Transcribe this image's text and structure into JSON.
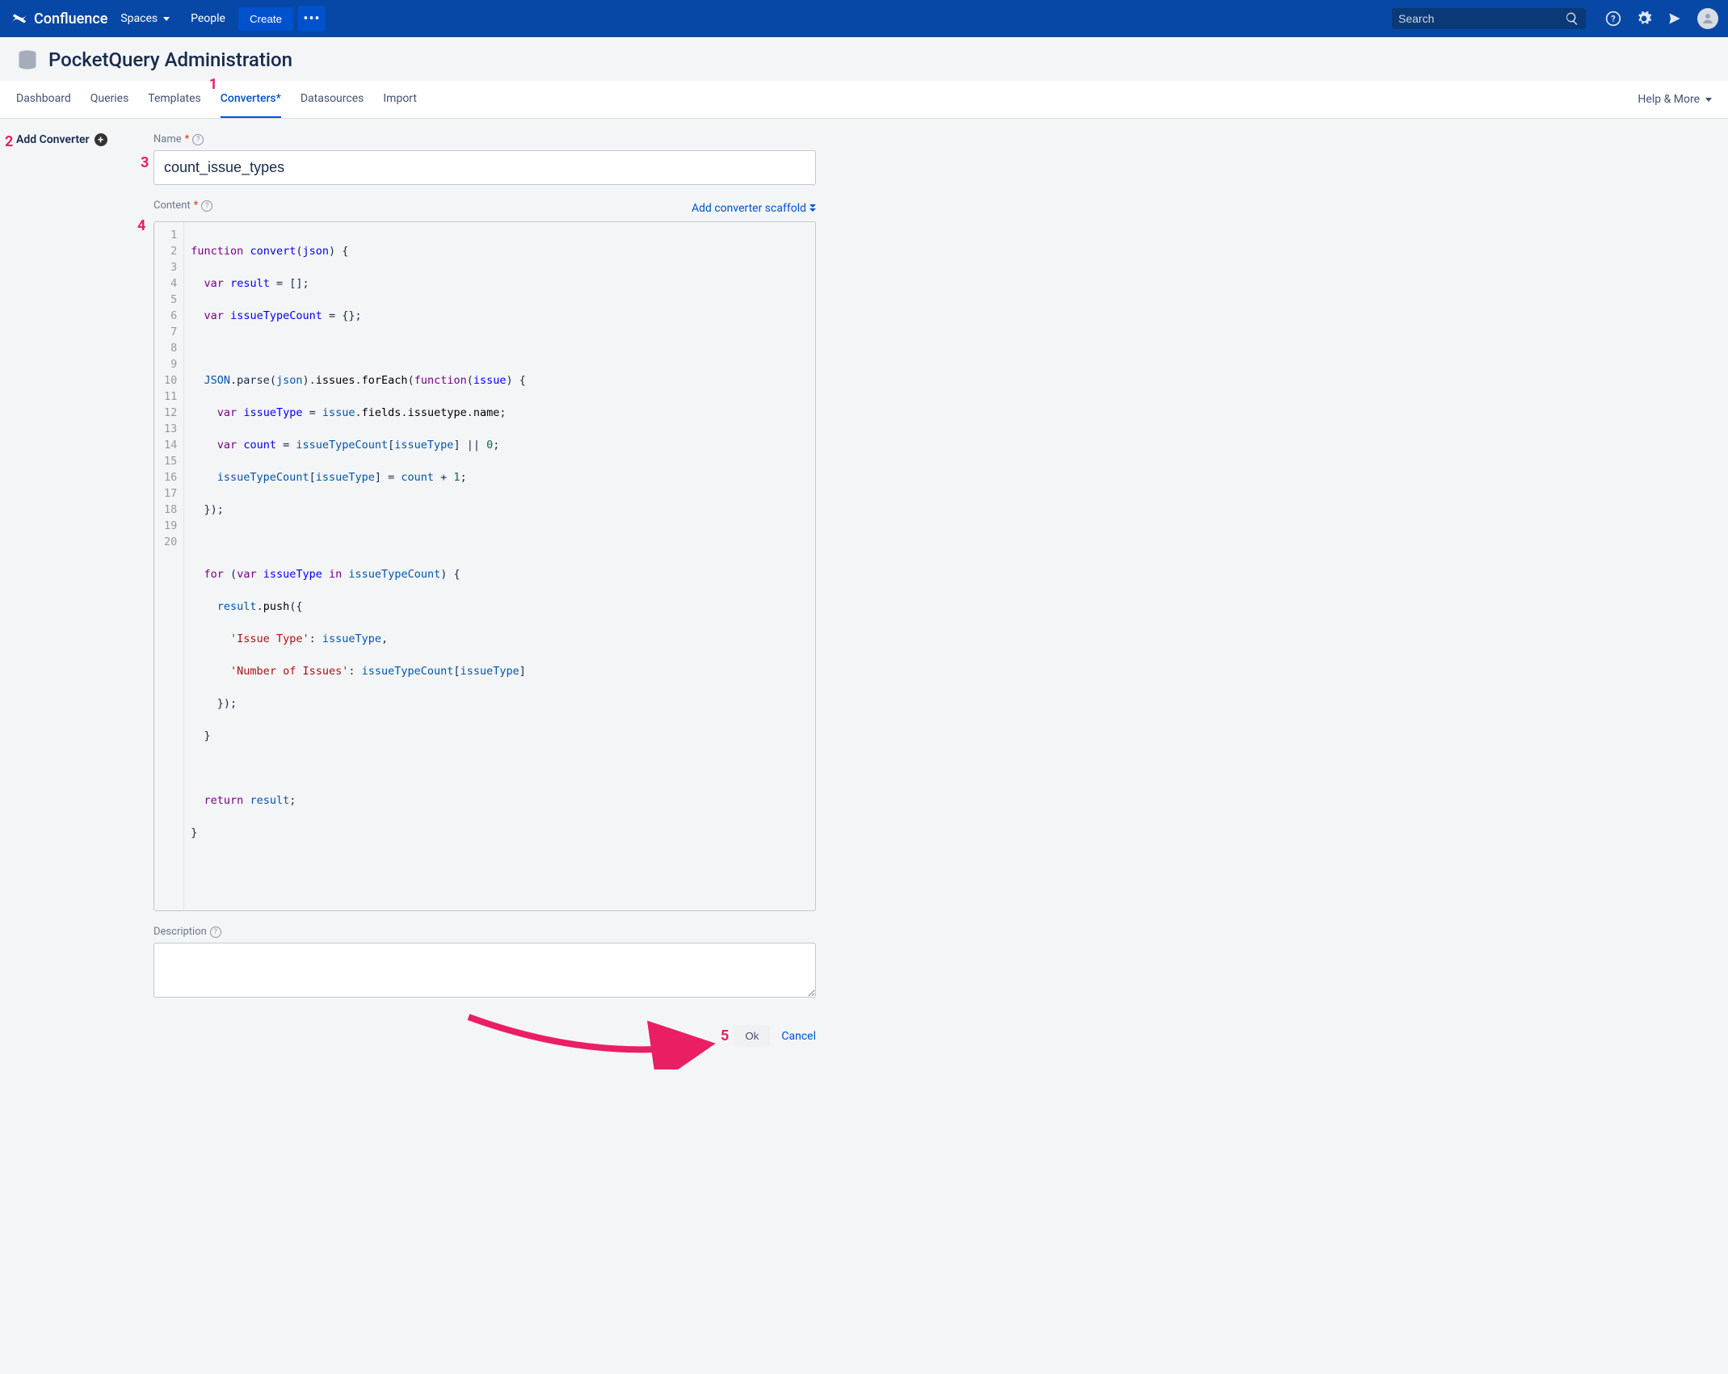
{
  "topbar": {
    "product": "Confluence",
    "spaces": "Spaces",
    "people": "People",
    "create": "Create",
    "more": "•••",
    "search_placeholder": "Search"
  },
  "page": {
    "title": "PocketQuery Administration"
  },
  "tabs": {
    "dashboard": "Dashboard",
    "queries": "Queries",
    "templates": "Templates",
    "converters": "Converters*",
    "datasources": "Datasources",
    "import": "Import",
    "help": "Help & More"
  },
  "sidebar": {
    "add_converter": "Add Converter"
  },
  "form": {
    "name_label": "Name",
    "name_value": "count_issue_types",
    "content_label": "Content",
    "scaffold": "Add converter scaffold",
    "description_label": "Description",
    "description_value": ""
  },
  "code": {
    "lines": 20,
    "line1_a": "function",
    "line1_b": "convert",
    "line1_c": "(",
    "line1_d": "json",
    "line1_e": ") {",
    "line2_a": "var",
    "line2_b": "result",
    "line2_c": " = [];",
    "line3_a": "var",
    "line3_b": "issueTypeCount",
    "line3_c": " = {};",
    "line5_a": "JSON",
    "line5_b": ".parse(",
    "line5_c": "json",
    "line5_d": ").",
    "line5_e": "issues",
    "line5_f": ".",
    "line5_g": "forEach",
    "line5_h": "(",
    "line5_i": "function",
    "line5_j": "(",
    "line5_k": "issue",
    "line5_l": ") {",
    "line6_a": "var",
    "line6_b": "issueType",
    "line6_c": " = ",
    "line6_d": "issue",
    "line6_e": ".",
    "line6_f": "fields",
    "line6_g": ".",
    "line6_h": "issuetype",
    "line6_i": ".",
    "line6_j": "name",
    "line6_k": ";",
    "line7_a": "var",
    "line7_b": "count",
    "line7_c": " = ",
    "line7_d": "issueTypeCount",
    "line7_e": "[",
    "line7_f": "issueType",
    "line7_g": "] || ",
    "line7_h": "0",
    "line7_i": ";",
    "line8_a": "issueTypeCount",
    "line8_b": "[",
    "line8_c": "issueType",
    "line8_d": "] = ",
    "line8_e": "count",
    "line8_f": " + ",
    "line8_g": "1",
    "line8_h": ";",
    "line9": "  });",
    "line11_a": "for",
    "line11_b": " (",
    "line11_c": "var",
    "line11_d": " ",
    "line11_e": "issueType",
    "line11_f": " ",
    "line11_g": "in",
    "line11_h": " ",
    "line11_i": "issueTypeCount",
    "line11_j": ") {",
    "line12_a": "result",
    "line12_b": ".",
    "line12_c": "push",
    "line12_d": "({",
    "line13_a": "'Issue Type'",
    "line13_b": ": ",
    "line13_c": "issueType",
    "line13_d": ",",
    "line14_a": "'Number of Issues'",
    "line14_b": ": ",
    "line14_c": "issueTypeCount",
    "line14_d": "[",
    "line14_e": "issueType",
    "line14_f": "]",
    "line15": "    });",
    "line16": "  }",
    "line18_a": "return",
    "line18_b": " ",
    "line18_c": "result",
    "line18_d": ";",
    "line19": "}"
  },
  "actions": {
    "ok": "Ok",
    "cancel": "Cancel"
  },
  "callouts": {
    "c1": "1",
    "c2": "2",
    "c3": "3",
    "c4": "4",
    "c5": "5"
  }
}
